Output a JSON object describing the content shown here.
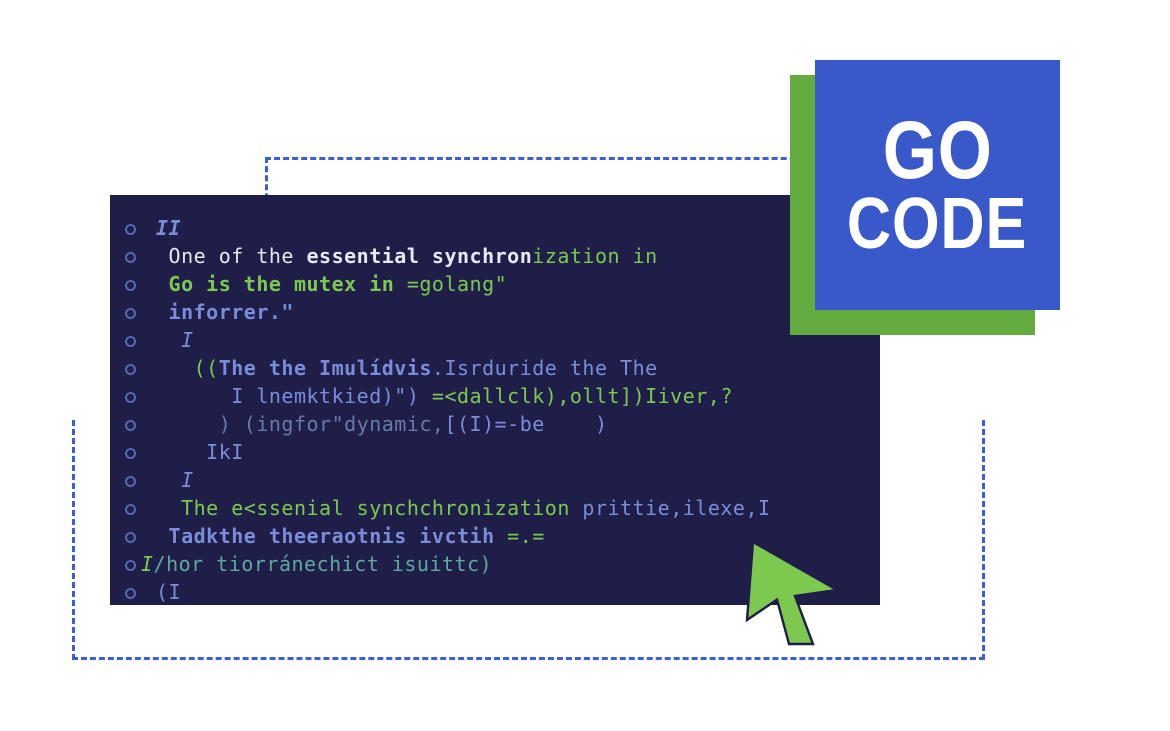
{
  "logo": {
    "line1": "GO",
    "line2": "CODE"
  },
  "code": {
    "lines": [
      {
        "segments": [
          {
            "text": "II",
            "class": "c-blue italic bold"
          }
        ],
        "indent": 0
      },
      {
        "segments": [
          {
            "text": " One of the ",
            "class": "c-white"
          },
          {
            "text": "essential synchron",
            "class": "c-white bold"
          },
          {
            "text": "ization in",
            "class": "c-green"
          }
        ],
        "indent": 0
      },
      {
        "segments": [
          {
            "text": " Go is the mutex in ",
            "class": "c-green bold"
          },
          {
            "text": "=golang\"",
            "class": "c-green"
          }
        ],
        "indent": 0
      },
      {
        "segments": [
          {
            "text": " inforrer.\"",
            "class": "c-blue bold"
          }
        ],
        "indent": 0
      },
      {
        "segments": [
          {
            "text": "  I",
            "class": "c-blue italic"
          }
        ],
        "indent": 0
      },
      {
        "segments": [
          {
            "text": "   ((",
            "class": "c-green"
          },
          {
            "text": "The the Imulídvis",
            "class": "c-blue bold"
          },
          {
            "text": ".Isrduride the The",
            "class": "c-blue"
          }
        ],
        "indent": 0
      },
      {
        "segments": [
          {
            "text": "      I lnemktkied)\") ",
            "class": "c-blue"
          },
          {
            "text": "=<dallclk),ollt])Iiver,?",
            "class": "c-green"
          }
        ],
        "indent": 0
      },
      {
        "segments": [
          {
            "text": "     ) (ingfor\"dynamic,",
            "class": "c-gray"
          },
          {
            "text": "[(I)=-",
            "class": "c-blue"
          },
          {
            "text": "be    )",
            "class": "c-blue"
          }
        ],
        "indent": 0
      },
      {
        "segments": [
          {
            "text": "    IkI",
            "class": "c-blue"
          }
        ],
        "indent": 0
      },
      {
        "segments": [
          {
            "text": "  I",
            "class": "c-blue italic"
          }
        ],
        "indent": 0
      },
      {
        "segments": [
          {
            "text": "  The e<ssenial synchchronization ",
            "class": "c-green"
          },
          {
            "text": "prittie,ilexe,I",
            "class": "c-blue"
          }
        ],
        "indent": 0
      },
      {
        "segments": [
          {
            "text": " Tadkthe theeraotnis ivctih ",
            "class": "c-blue bold"
          },
          {
            "text": "=.=",
            "class": "c-green"
          }
        ],
        "indent": 0
      },
      {
        "segments": [
          {
            "text": "I",
            "class": "c-green italic"
          },
          {
            "text": "/hor tiorránechict isuittc)",
            "class": "c-teal"
          }
        ],
        "indent": -15
      },
      {
        "segments": [
          {
            "text": "(I",
            "class": "c-blue"
          }
        ],
        "indent": 0
      }
    ]
  }
}
